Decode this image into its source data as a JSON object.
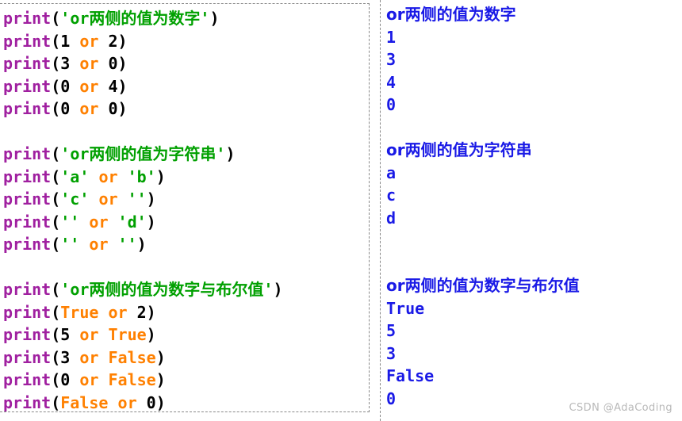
{
  "watermark": "CSDN @AdaCoding",
  "colors": {
    "function": "#a020a0",
    "string": "#00a000",
    "keyword": "#ff8000",
    "boolean": "#ff8000",
    "number": "#000000",
    "punctuation": "#000000",
    "output": "#1a1ae6",
    "watermark": "#b9b9b9",
    "border": "#8a8a8a",
    "background": "#ffffff"
  },
  "code_panel": {
    "language": "python",
    "lines": [
      {
        "tokens": [
          {
            "t": "print",
            "c": "fn"
          },
          {
            "t": "(",
            "c": "punct"
          },
          {
            "t": "'",
            "c": "str"
          },
          {
            "t": "or",
            "c": "str"
          },
          {
            "t": "两侧的值为数字",
            "c": "str",
            "cjk": true
          },
          {
            "t": "'",
            "c": "str"
          },
          {
            "t": ")",
            "c": "punct"
          }
        ]
      },
      {
        "tokens": [
          {
            "t": "print",
            "c": "fn"
          },
          {
            "t": "(",
            "c": "punct"
          },
          {
            "t": "1",
            "c": "num"
          },
          {
            "t": " ",
            "c": "punct"
          },
          {
            "t": "or",
            "c": "kw"
          },
          {
            "t": " ",
            "c": "punct"
          },
          {
            "t": "2",
            "c": "num"
          },
          {
            "t": ")",
            "c": "punct"
          }
        ]
      },
      {
        "tokens": [
          {
            "t": "print",
            "c": "fn"
          },
          {
            "t": "(",
            "c": "punct"
          },
          {
            "t": "3",
            "c": "num"
          },
          {
            "t": " ",
            "c": "punct"
          },
          {
            "t": "or",
            "c": "kw"
          },
          {
            "t": " ",
            "c": "punct"
          },
          {
            "t": "0",
            "c": "num"
          },
          {
            "t": ")",
            "c": "punct"
          }
        ]
      },
      {
        "tokens": [
          {
            "t": "print",
            "c": "fn"
          },
          {
            "t": "(",
            "c": "punct"
          },
          {
            "t": "0",
            "c": "num"
          },
          {
            "t": " ",
            "c": "punct"
          },
          {
            "t": "or",
            "c": "kw"
          },
          {
            "t": " ",
            "c": "punct"
          },
          {
            "t": "4",
            "c": "num"
          },
          {
            "t": ")",
            "c": "punct"
          }
        ]
      },
      {
        "tokens": [
          {
            "t": "print",
            "c": "fn"
          },
          {
            "t": "(",
            "c": "punct"
          },
          {
            "t": "0",
            "c": "num"
          },
          {
            "t": " ",
            "c": "punct"
          },
          {
            "t": "or",
            "c": "kw"
          },
          {
            "t": " ",
            "c": "punct"
          },
          {
            "t": "0",
            "c": "num"
          },
          {
            "t": ")",
            "c": "punct"
          }
        ]
      },
      {
        "tokens": []
      },
      {
        "tokens": [
          {
            "t": "print",
            "c": "fn"
          },
          {
            "t": "(",
            "c": "punct"
          },
          {
            "t": "'",
            "c": "str"
          },
          {
            "t": "or",
            "c": "str"
          },
          {
            "t": "两侧的值为字符串",
            "c": "str",
            "cjk": true
          },
          {
            "t": "'",
            "c": "str"
          },
          {
            "t": ")",
            "c": "punct"
          }
        ]
      },
      {
        "tokens": [
          {
            "t": "print",
            "c": "fn"
          },
          {
            "t": "(",
            "c": "punct"
          },
          {
            "t": "'a'",
            "c": "str"
          },
          {
            "t": " ",
            "c": "punct"
          },
          {
            "t": "or",
            "c": "kw"
          },
          {
            "t": " ",
            "c": "punct"
          },
          {
            "t": "'b'",
            "c": "str"
          },
          {
            "t": ")",
            "c": "punct"
          }
        ]
      },
      {
        "tokens": [
          {
            "t": "print",
            "c": "fn"
          },
          {
            "t": "(",
            "c": "punct"
          },
          {
            "t": "'c'",
            "c": "str"
          },
          {
            "t": " ",
            "c": "punct"
          },
          {
            "t": "or",
            "c": "kw"
          },
          {
            "t": " ",
            "c": "punct"
          },
          {
            "t": "''",
            "c": "str"
          },
          {
            "t": ")",
            "c": "punct"
          }
        ]
      },
      {
        "tokens": [
          {
            "t": "print",
            "c": "fn"
          },
          {
            "t": "(",
            "c": "punct"
          },
          {
            "t": "''",
            "c": "str"
          },
          {
            "t": " ",
            "c": "punct"
          },
          {
            "t": "or",
            "c": "kw"
          },
          {
            "t": " ",
            "c": "punct"
          },
          {
            "t": "'d'",
            "c": "str"
          },
          {
            "t": ")",
            "c": "punct"
          }
        ]
      },
      {
        "tokens": [
          {
            "t": "print",
            "c": "fn"
          },
          {
            "t": "(",
            "c": "punct"
          },
          {
            "t": "''",
            "c": "str"
          },
          {
            "t": " ",
            "c": "punct"
          },
          {
            "t": "or",
            "c": "kw"
          },
          {
            "t": " ",
            "c": "punct"
          },
          {
            "t": "''",
            "c": "str"
          },
          {
            "t": ")",
            "c": "punct"
          }
        ]
      },
      {
        "tokens": []
      },
      {
        "tokens": [
          {
            "t": "print",
            "c": "fn"
          },
          {
            "t": "(",
            "c": "punct"
          },
          {
            "t": "'",
            "c": "str"
          },
          {
            "t": "or",
            "c": "str"
          },
          {
            "t": "两侧的值为数字与布尔值",
            "c": "str",
            "cjk": true
          },
          {
            "t": "'",
            "c": "str"
          },
          {
            "t": ")",
            "c": "punct"
          }
        ]
      },
      {
        "tokens": [
          {
            "t": "print",
            "c": "fn"
          },
          {
            "t": "(",
            "c": "punct"
          },
          {
            "t": "True",
            "c": "bool"
          },
          {
            "t": " ",
            "c": "punct"
          },
          {
            "t": "or",
            "c": "kw"
          },
          {
            "t": " ",
            "c": "punct"
          },
          {
            "t": "2",
            "c": "num"
          },
          {
            "t": ")",
            "c": "punct"
          }
        ]
      },
      {
        "tokens": [
          {
            "t": "print",
            "c": "fn"
          },
          {
            "t": "(",
            "c": "punct"
          },
          {
            "t": "5",
            "c": "num"
          },
          {
            "t": " ",
            "c": "punct"
          },
          {
            "t": "or",
            "c": "kw"
          },
          {
            "t": " ",
            "c": "punct"
          },
          {
            "t": "True",
            "c": "bool"
          },
          {
            "t": ")",
            "c": "punct"
          }
        ]
      },
      {
        "tokens": [
          {
            "t": "print",
            "c": "fn"
          },
          {
            "t": "(",
            "c": "punct"
          },
          {
            "t": "3",
            "c": "num"
          },
          {
            "t": " ",
            "c": "punct"
          },
          {
            "t": "or",
            "c": "kw"
          },
          {
            "t": " ",
            "c": "punct"
          },
          {
            "t": "False",
            "c": "bool"
          },
          {
            "t": ")",
            "c": "punct"
          }
        ]
      },
      {
        "tokens": [
          {
            "t": "print",
            "c": "fn"
          },
          {
            "t": "(",
            "c": "punct"
          },
          {
            "t": "0",
            "c": "num"
          },
          {
            "t": " ",
            "c": "punct"
          },
          {
            "t": "or",
            "c": "kw"
          },
          {
            "t": " ",
            "c": "punct"
          },
          {
            "t": "False",
            "c": "bool"
          },
          {
            "t": ")",
            "c": "punct"
          }
        ]
      },
      {
        "tokens": [
          {
            "t": "print",
            "c": "fn"
          },
          {
            "t": "(",
            "c": "punct"
          },
          {
            "t": "False",
            "c": "bool"
          },
          {
            "t": " ",
            "c": "punct"
          },
          {
            "t": "or",
            "c": "kw"
          },
          {
            "t": " ",
            "c": "punct"
          },
          {
            "t": "0",
            "c": "num"
          },
          {
            "t": ")",
            "c": "punct"
          }
        ]
      }
    ]
  },
  "output_panel": {
    "lines": [
      {
        "text": "or两侧的值为数字",
        "cjk": true
      },
      {
        "text": "1"
      },
      {
        "text": "3"
      },
      {
        "text": "4"
      },
      {
        "text": "0"
      },
      {
        "text": ""
      },
      {
        "text": "or两侧的值为字符串",
        "cjk": true
      },
      {
        "text": "a"
      },
      {
        "text": "c"
      },
      {
        "text": "d"
      },
      {
        "text": ""
      },
      {
        "text": ""
      },
      {
        "text": "or两侧的值为数字与布尔值",
        "cjk": true
      },
      {
        "text": "True"
      },
      {
        "text": "5"
      },
      {
        "text": "3"
      },
      {
        "text": "False"
      },
      {
        "text": "0"
      }
    ]
  }
}
